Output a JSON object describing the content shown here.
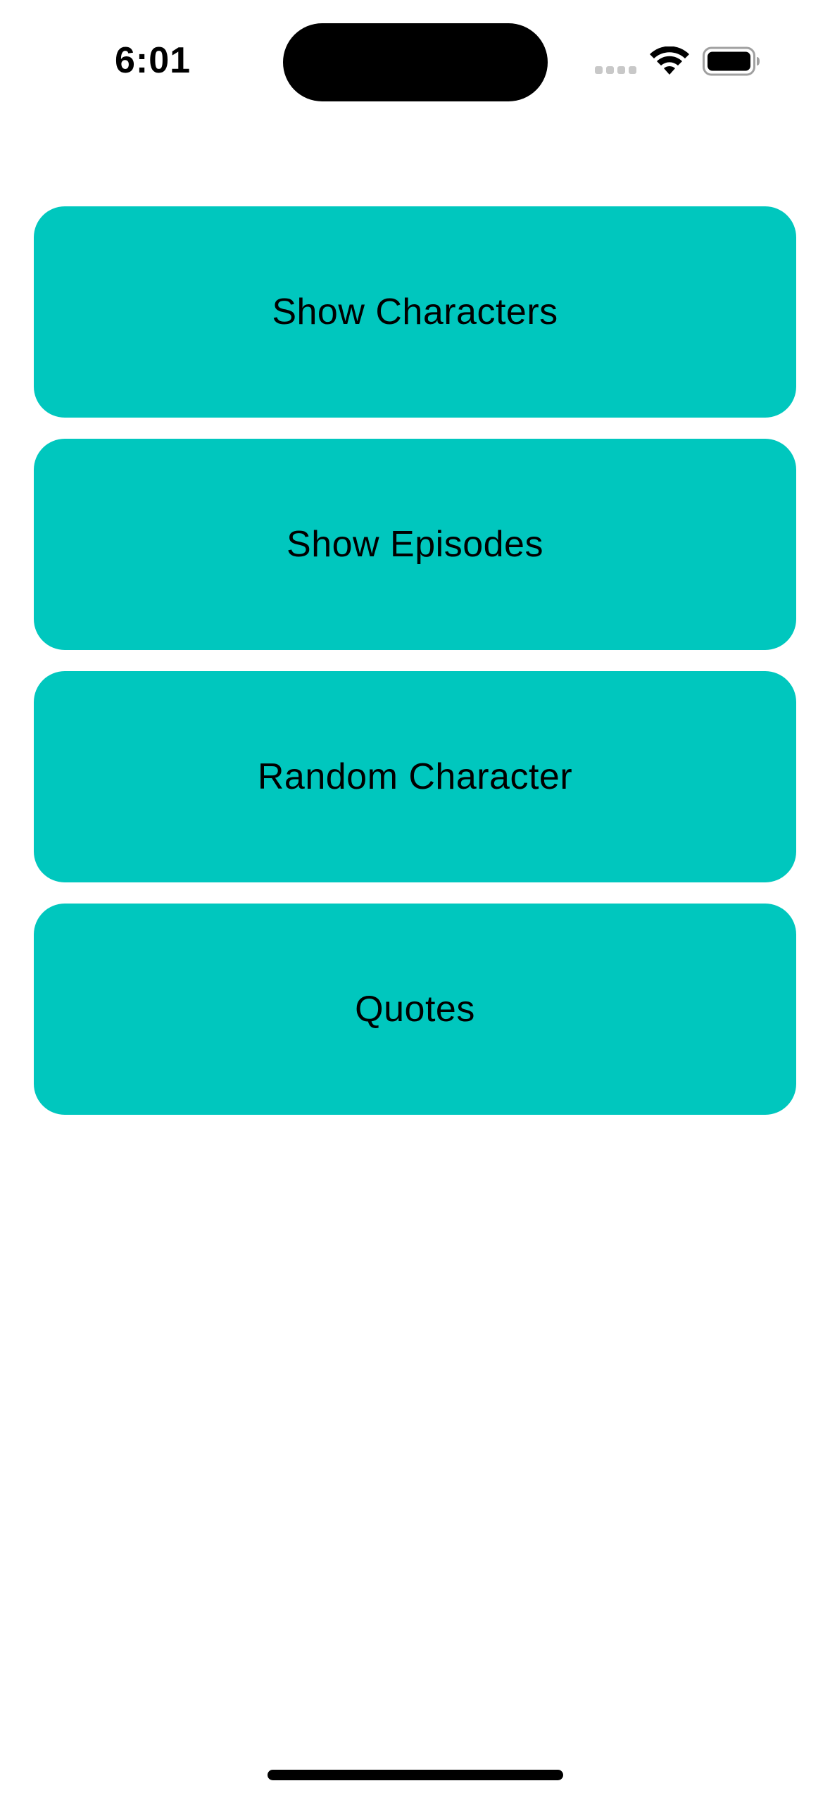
{
  "status_bar": {
    "time": "6:01",
    "icons": [
      "signal-icon",
      "wifi-icon",
      "battery-icon"
    ]
  },
  "menu": {
    "accent_color": "#00c7be",
    "buttons": [
      {
        "label": "Show Characters"
      },
      {
        "label": "Show Episodes"
      },
      {
        "label": "Random Character"
      },
      {
        "label": "Quotes"
      }
    ]
  }
}
